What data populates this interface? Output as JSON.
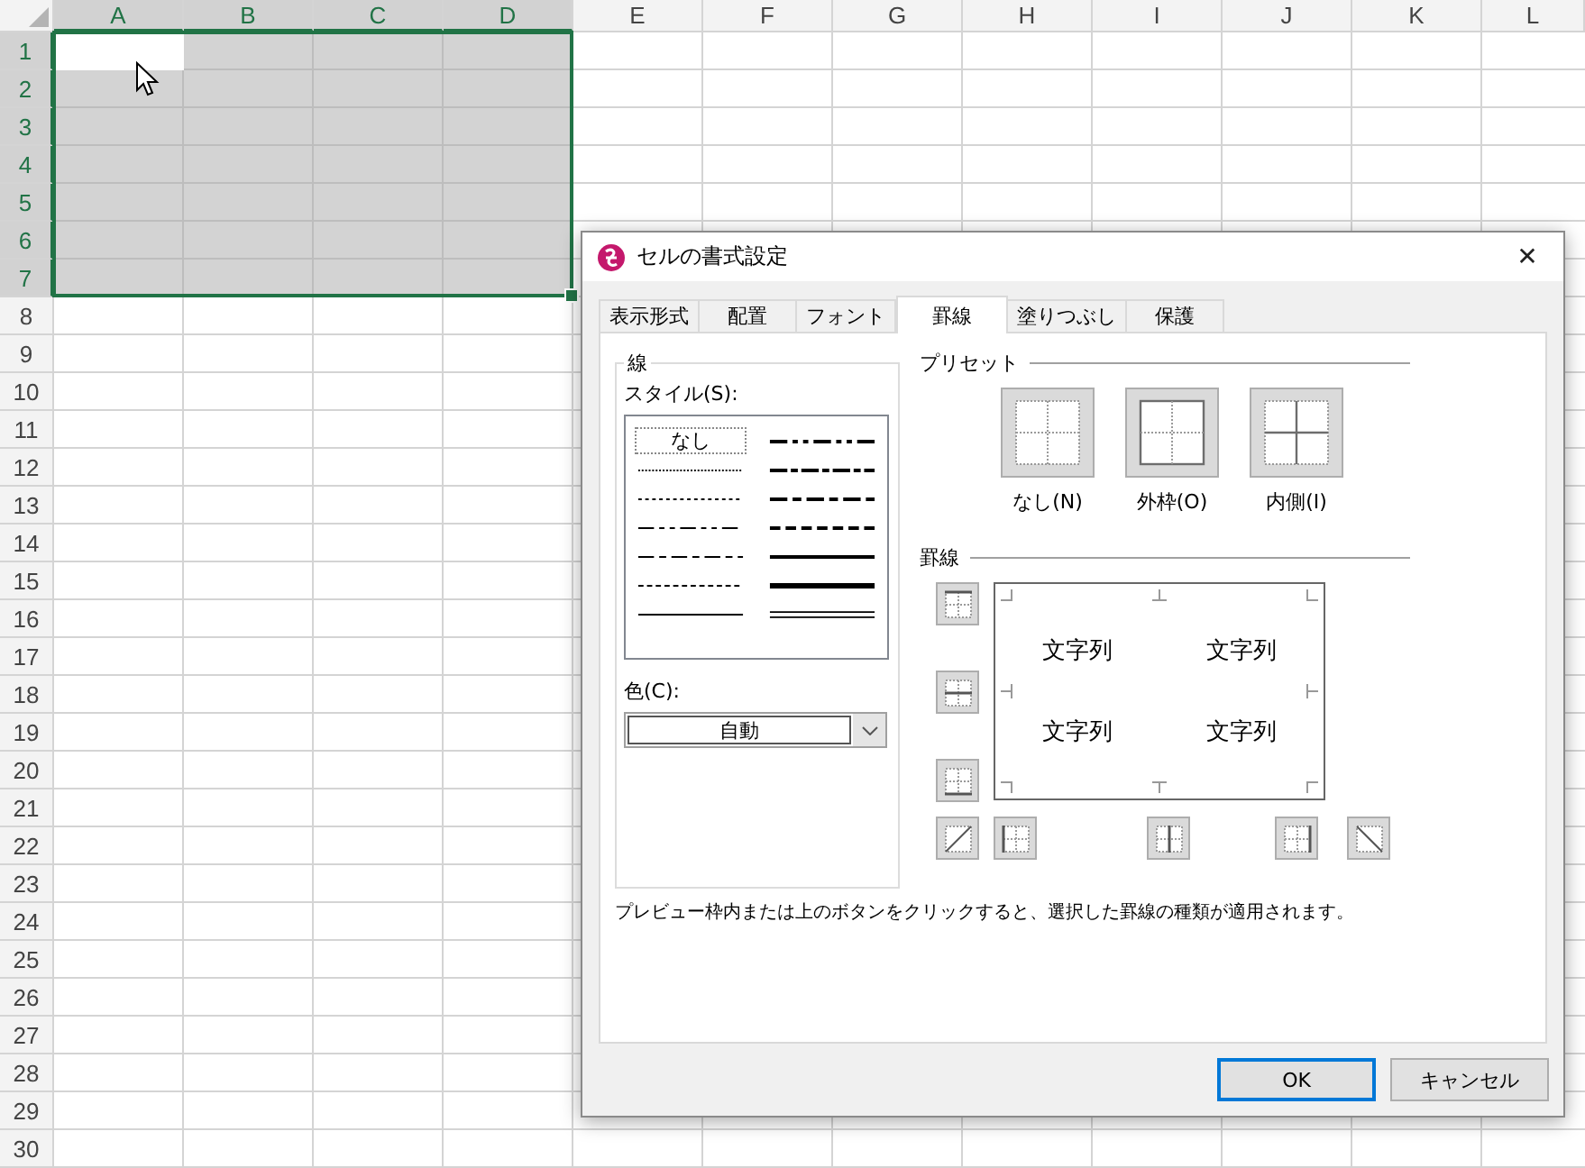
{
  "sheet": {
    "columns": [
      {
        "label": "A",
        "selected": true
      },
      {
        "label": "B",
        "selected": true
      },
      {
        "label": "C",
        "selected": true
      },
      {
        "label": "D",
        "selected": true
      },
      {
        "label": "E",
        "selected": false
      },
      {
        "label": "F",
        "selected": false
      },
      {
        "label": "G",
        "selected": false
      },
      {
        "label": "H",
        "selected": false
      },
      {
        "label": "I",
        "selected": false
      },
      {
        "label": "J",
        "selected": false
      },
      {
        "label": "K",
        "selected": false
      },
      {
        "label": "L",
        "selected": false
      }
    ],
    "rows": [
      {
        "label": "1",
        "selected": true
      },
      {
        "label": "2",
        "selected": true
      },
      {
        "label": "3",
        "selected": true
      },
      {
        "label": "4",
        "selected": true
      },
      {
        "label": "5",
        "selected": true
      },
      {
        "label": "6",
        "selected": true
      },
      {
        "label": "7",
        "selected": true
      },
      {
        "label": "8",
        "selected": false
      },
      {
        "label": "9",
        "selected": false
      },
      {
        "label": "10",
        "selected": false
      },
      {
        "label": "11",
        "selected": false
      },
      {
        "label": "12",
        "selected": false
      },
      {
        "label": "13",
        "selected": false
      },
      {
        "label": "14",
        "selected": false
      },
      {
        "label": "15",
        "selected": false
      },
      {
        "label": "16",
        "selected": false
      },
      {
        "label": "17",
        "selected": false
      },
      {
        "label": "18",
        "selected": false
      },
      {
        "label": "19",
        "selected": false
      },
      {
        "label": "20",
        "selected": false
      },
      {
        "label": "21",
        "selected": false
      },
      {
        "label": "22",
        "selected": false
      },
      {
        "label": "23",
        "selected": false
      },
      {
        "label": "24",
        "selected": false
      },
      {
        "label": "25",
        "selected": false
      },
      {
        "label": "26",
        "selected": false
      },
      {
        "label": "27",
        "selected": false
      },
      {
        "label": "28",
        "selected": false
      },
      {
        "label": "29",
        "selected": false
      },
      {
        "label": "30",
        "selected": false
      }
    ]
  },
  "dialog": {
    "title": "セルの書式設定",
    "close": "✕",
    "tabs": [
      {
        "label": "表示形式",
        "selected": false
      },
      {
        "label": "配置",
        "selected": false
      },
      {
        "label": "フォント",
        "selected": false
      },
      {
        "label": "罫線",
        "selected": true
      },
      {
        "label": "塗りつぶし",
        "selected": false
      },
      {
        "label": "保護",
        "selected": false
      }
    ],
    "line_group": {
      "title": "線",
      "style_label": "スタイル(S):",
      "styles": [
        {
          "kind": "none",
          "label": "なし",
          "selected": true
        },
        {
          "kind": "hair",
          "selected": false
        },
        {
          "kind": "dotted",
          "selected": false
        },
        {
          "kind": "dash_dot_dot",
          "selected": false
        },
        {
          "kind": "dash_dot",
          "selected": false
        },
        {
          "kind": "dashed",
          "selected": false
        },
        {
          "kind": "thin",
          "selected": false
        },
        {
          "kind": "medium_dash_dot_dot",
          "selected": false
        },
        {
          "kind": "slant_dash_dot",
          "selected": false
        },
        {
          "kind": "medium_dash_dot",
          "selected": false
        },
        {
          "kind": "medium_dashed",
          "selected": false
        },
        {
          "kind": "medium",
          "selected": false
        },
        {
          "kind": "thick",
          "selected": false
        },
        {
          "kind": "double",
          "selected": false
        }
      ],
      "color_label": "色(C):",
      "color_value": "自動"
    },
    "presets": {
      "title": "プリセット",
      "items": [
        {
          "kind": "none",
          "label": "なし(N)"
        },
        {
          "kind": "outline",
          "label": "外枠(O)"
        },
        {
          "kind": "inside",
          "label": "内側(I)"
        }
      ]
    },
    "border": {
      "title": "罫線",
      "side_buttons": [
        {
          "kind": "top"
        },
        {
          "kind": "middle"
        },
        {
          "kind": "bottom"
        }
      ],
      "bottom_buttons": [
        {
          "kind": "diagonal_up"
        },
        {
          "kind": "left"
        },
        {
          "kind": "center"
        },
        {
          "kind": "right"
        },
        {
          "kind": "diagonal_down"
        }
      ],
      "preview_texts": [
        "文字列",
        "文字列",
        "文字列",
        "文字列"
      ]
    },
    "hint": "プレビュー枠内または上のボタンをクリックすると、選択した罫線の種類が適用されます。",
    "buttons": [
      {
        "label": "OK",
        "default": true
      },
      {
        "label": "キャンセル",
        "default": false
      }
    ]
  }
}
